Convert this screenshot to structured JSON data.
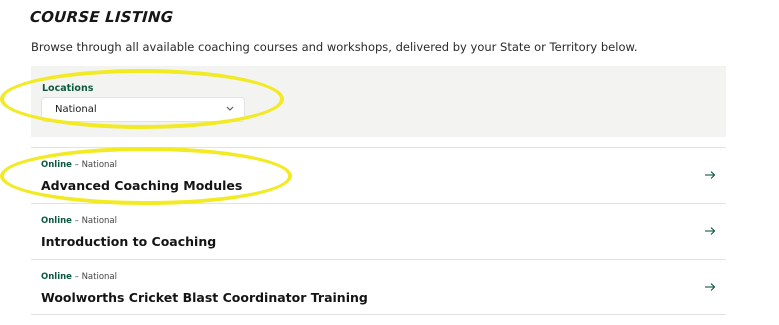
{
  "header": {
    "title": "COURSE LISTING",
    "intro": "Browse through all available coaching courses and workshops, delivered by your State or Territory below."
  },
  "filter": {
    "label": "Locations",
    "selected": "National"
  },
  "courses": [
    {
      "mode": "Online",
      "separator": " – ",
      "location": "National",
      "title": "Advanced Coaching Modules"
    },
    {
      "mode": "Online",
      "separator": " – ",
      "location": "National",
      "title": "Introduction to Coaching"
    },
    {
      "mode": "Online",
      "separator": " – ",
      "location": "National",
      "title": "Woolworths Cricket Blast Coordinator Training"
    }
  ],
  "icons": {
    "dropdown": "chevron-down-icon",
    "row": "arrow-right-icon"
  },
  "colors": {
    "accent_green": "#0d5a3e",
    "highlight_yellow": "#f2ea22",
    "panel_bg": "#f3f3f2"
  }
}
